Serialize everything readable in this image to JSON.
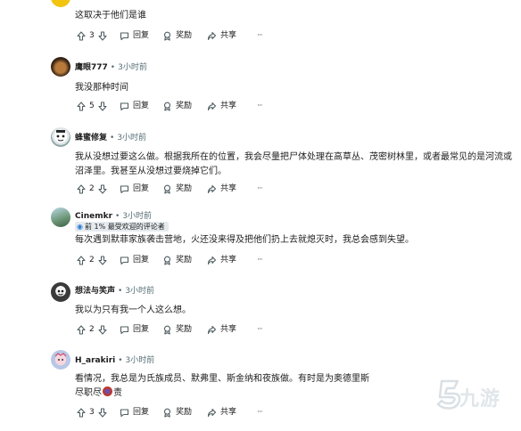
{
  "comments": [
    {
      "user": "",
      "time": "",
      "text": "这取决于他们是谁",
      "votes": "3",
      "reply": "回复",
      "award": "奖励",
      "share": "共享",
      "more": "···"
    },
    {
      "user": "鹰眼777",
      "time": "3小时前",
      "text": "我没那种时间",
      "votes": "5",
      "reply": "回复",
      "award": "奖励",
      "share": "共享",
      "more": "···"
    },
    {
      "user": "蜂蜜修复",
      "time": "3小时前",
      "text": "我从没想过要这么做。根据我所在的位置，我会尽量把尸体处理在高草丛、茂密树林里，或者最常见的是河流或沼泽里。我甚至从没想过要烧掉它们。",
      "votes": "2",
      "reply": "回复",
      "award": "奖励",
      "share": "共享",
      "more": "···"
    },
    {
      "user": "Cinemkr",
      "time": "3小时前",
      "flair": "前 1% 最受欢迎的评论者",
      "text": "每次遇到默菲家族袭击营地，火还没来得及把他们扔上去就熄灭时，我总会感到失望。",
      "votes": "2",
      "reply": "回复",
      "award": "奖励",
      "share": "共享",
      "more": "···"
    },
    {
      "user": "想法与笑声",
      "time": "3小时前",
      "text": "我以为只有我一个人这么想。",
      "votes": "2",
      "reply": "回复",
      "award": "奖励",
      "share": "共享",
      "more": "···"
    },
    {
      "user": "H_arakiri",
      "time": "3小时前",
      "text": "看情况，我总是为氏族成员、默弗里、斯金纳和夜族做。有时是为奥德里斯",
      "text2": "尽职尽",
      "text3": "责",
      "votes": "3",
      "reply": "回复",
      "award": "奖励",
      "share": "共享",
      "more": "···"
    }
  ],
  "watermark": "九游",
  "colors": {
    "text": "#1c1c1c",
    "meta": "#576f76",
    "flair_bg": "#e5ebee",
    "flair_icon": "#2a7ad6"
  },
  "icons": [
    "upvote-icon",
    "downvote-icon",
    "reply-icon",
    "award-icon",
    "share-icon",
    "more-icon"
  ]
}
